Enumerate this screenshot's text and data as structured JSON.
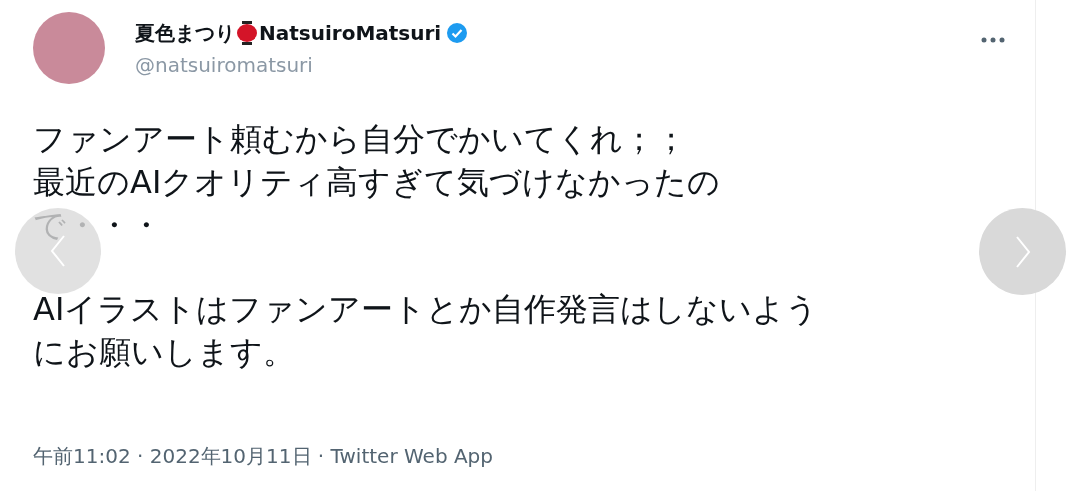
{
  "author": {
    "display_name": "夏色まつり",
    "name_suffix": "NatsuiroMatsuri",
    "verified": true,
    "handle": "@natsuiromatsuri"
  },
  "body": [
    [
      "ファンアート頼むから自分でかいてくれ；；",
      "最近のAIクオリティ高すぎて気づけなかったの",
      "で・・・"
    ],
    [
      "AIイラストはファンアートとか自作発言はしないよう",
      "にお願いします。"
    ]
  ],
  "meta": "午前11:02 · 2022年10月11日 · Twitter Web App"
}
